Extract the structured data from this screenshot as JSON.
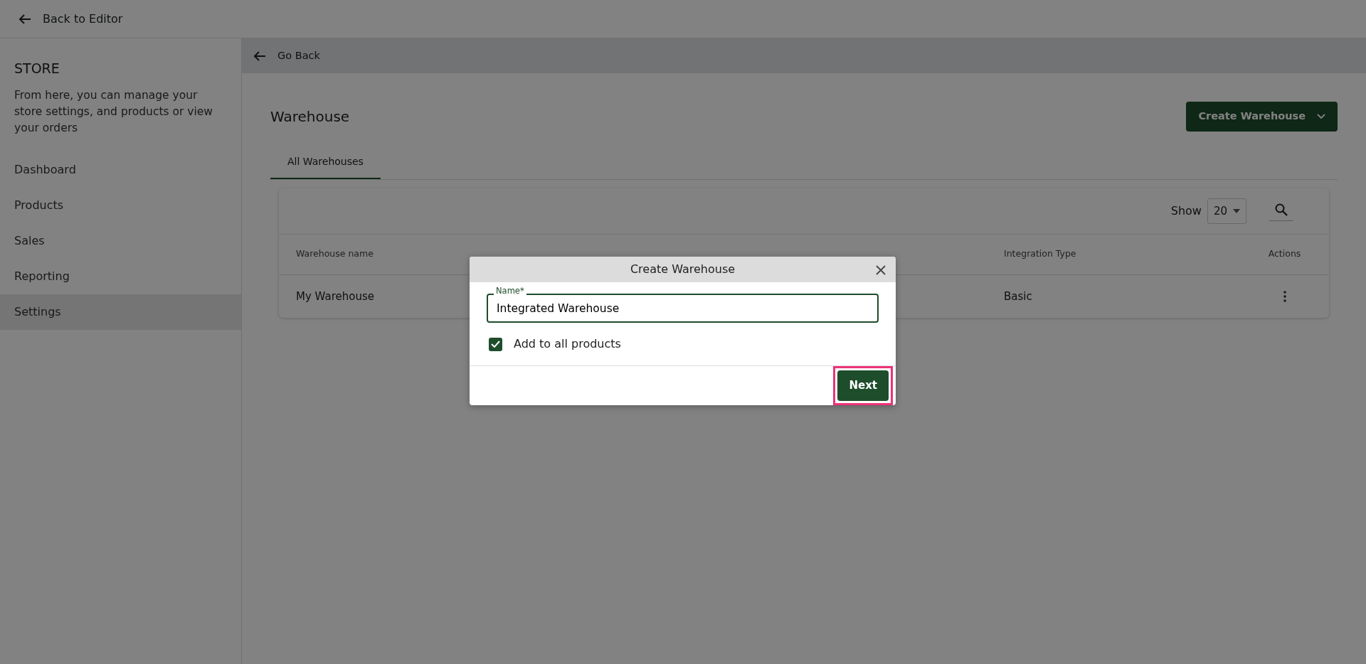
{
  "top_bar": {
    "back_link": "Back to Editor"
  },
  "sidebar": {
    "title": "STORE",
    "description": "From here, you can manage your store settings, and products or view your orders",
    "items": [
      {
        "label": "Dashboard",
        "selected": false
      },
      {
        "label": "Products",
        "selected": false
      },
      {
        "label": "Sales",
        "selected": false
      },
      {
        "label": "Reporting",
        "selected": false
      },
      {
        "label": "Settings",
        "selected": true
      }
    ]
  },
  "page": {
    "back_link": "Go Back",
    "title": "Warehouse",
    "create_button": "Create Warehouse",
    "tabs": [
      {
        "label": "All Warehouses",
        "selected": true
      }
    ],
    "table": {
      "show_label": "Show",
      "page_size": "20",
      "columns": [
        "Warehouse name",
        "Integration Type",
        "Actions"
      ],
      "rows": [
        {
          "warehouse_name": "My Warehouse",
          "integration_type": "Basic"
        }
      ]
    }
  },
  "modal": {
    "title": "Create Warehouse",
    "name_field": {
      "label": "Name",
      "required_mark": "*",
      "value": "Integrated Warehouse"
    },
    "checkbox": {
      "label": "Add to all products",
      "checked": true
    },
    "next_button": {
      "label": "Next",
      "highlighted": true
    }
  }
}
